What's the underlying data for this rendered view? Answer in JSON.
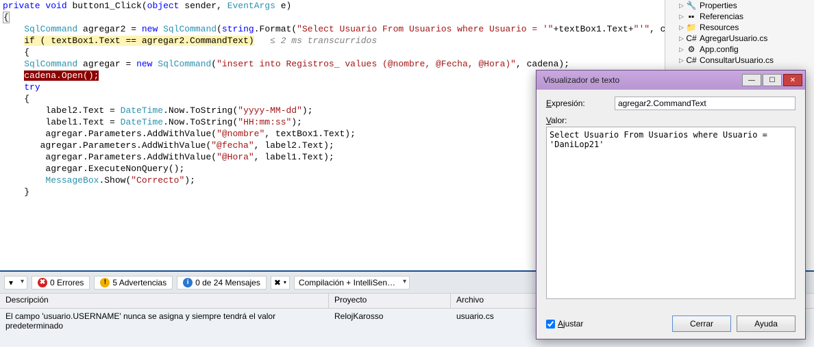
{
  "code": {
    "lines": [
      {
        "segments": [
          {
            "t": "private",
            "c": "kw"
          },
          {
            "t": " ",
            "c": ""
          },
          {
            "t": "void",
            "c": "kw"
          },
          {
            "t": " button1_Click(",
            "c": ""
          },
          {
            "t": "object",
            "c": "kw"
          },
          {
            "t": " sender, ",
            "c": ""
          },
          {
            "t": "EventArgs",
            "c": "type"
          },
          {
            "t": " e)",
            "c": ""
          }
        ]
      },
      {
        "segments": [
          {
            "t": "{",
            "c": "bracket-outline"
          }
        ]
      },
      {
        "segments": [
          {
            "t": "",
            "c": ""
          }
        ]
      },
      {
        "segments": [
          {
            "t": "",
            "c": ""
          }
        ]
      },
      {
        "segments": [
          {
            "t": "    ",
            "c": ""
          },
          {
            "t": "SqlCommand",
            "c": "type"
          },
          {
            "t": " agregar2 = ",
            "c": ""
          },
          {
            "t": "new",
            "c": "kw"
          },
          {
            "t": " ",
            "c": ""
          },
          {
            "t": "SqlCommand",
            "c": "type"
          },
          {
            "t": "(",
            "c": ""
          },
          {
            "t": "string",
            "c": "kw"
          },
          {
            "t": ".Format(",
            "c": ""
          },
          {
            "t": "\"Select Usuario From Usuarios where Usuario = '\"",
            "c": "str"
          },
          {
            "t": "+textBox1.Text+",
            "c": ""
          },
          {
            "t": "\"'\"",
            "c": "str"
          },
          {
            "t": ", cadena));",
            "c": ""
          }
        ]
      },
      {
        "segments": [
          {
            "t": "",
            "c": ""
          }
        ]
      },
      {
        "segments": [
          {
            "t": "    ",
            "c": ""
          },
          {
            "t": "if ( textBox1.Text == agregar2.CommandText)",
            "c": "hl-yellow"
          },
          {
            "t": "   ≤ 2 ms transcurridos",
            "c": "comment"
          }
        ]
      },
      {
        "segments": [
          {
            "t": "    {",
            "c": ""
          }
        ]
      },
      {
        "segments": [
          {
            "t": "",
            "c": ""
          }
        ]
      },
      {
        "segments": [
          {
            "t": "    ",
            "c": ""
          },
          {
            "t": "SqlCommand",
            "c": "type"
          },
          {
            "t": " agregar = ",
            "c": ""
          },
          {
            "t": "new",
            "c": "kw"
          },
          {
            "t": " ",
            "c": ""
          },
          {
            "t": "SqlCommand",
            "c": "type"
          },
          {
            "t": "(",
            "c": ""
          },
          {
            "t": "\"insert into Registros_ values (@nombre, @Fecha, @Hora)\"",
            "c": "str"
          },
          {
            "t": ", cadena);",
            "c": ""
          }
        ]
      },
      {
        "segments": [
          {
            "t": "    ",
            "c": ""
          },
          {
            "t": "cadena.Open();",
            "c": "hl-red"
          }
        ]
      },
      {
        "segments": [
          {
            "t": "",
            "c": ""
          }
        ]
      },
      {
        "segments": [
          {
            "t": "    ",
            "c": ""
          },
          {
            "t": "try",
            "c": "kw"
          }
        ]
      },
      {
        "segments": [
          {
            "t": "    {",
            "c": ""
          }
        ]
      },
      {
        "segments": [
          {
            "t": "        label2.Text = ",
            "c": ""
          },
          {
            "t": "DateTime",
            "c": "type"
          },
          {
            "t": ".Now.ToString(",
            "c": ""
          },
          {
            "t": "\"yyyy-MM-dd\"",
            "c": "str"
          },
          {
            "t": ");",
            "c": ""
          }
        ]
      },
      {
        "segments": [
          {
            "t": "        label1.Text = ",
            "c": ""
          },
          {
            "t": "DateTime",
            "c": "type"
          },
          {
            "t": ".Now.ToString(",
            "c": ""
          },
          {
            "t": "\"HH:mm:ss\"",
            "c": "str"
          },
          {
            "t": ");",
            "c": ""
          }
        ]
      },
      {
        "segments": [
          {
            "t": "        agregar.Parameters.AddWithValue(",
            "c": ""
          },
          {
            "t": "\"@nombre\"",
            "c": "str"
          },
          {
            "t": ", textBox1.Text);",
            "c": ""
          }
        ]
      },
      {
        "segments": [
          {
            "t": "",
            "c": ""
          }
        ]
      },
      {
        "segments": [
          {
            "t": "       agregar.Parameters.AddWithValue(",
            "c": ""
          },
          {
            "t": "\"@fecha\"",
            "c": "str"
          },
          {
            "t": ", label2.Text);",
            "c": ""
          }
        ]
      },
      {
        "segments": [
          {
            "t": "        agregar.Parameters.AddWithValue(",
            "c": ""
          },
          {
            "t": "\"@Hora\"",
            "c": "str"
          },
          {
            "t": ", label1.Text);",
            "c": ""
          }
        ]
      },
      {
        "segments": [
          {
            "t": "        agregar.ExecuteNonQuery();",
            "c": ""
          }
        ]
      },
      {
        "segments": [
          {
            "t": "        ",
            "c": ""
          },
          {
            "t": "MessageBox",
            "c": "type"
          },
          {
            "t": ".Show(",
            "c": ""
          },
          {
            "t": "\"Correcto\"",
            "c": "str"
          },
          {
            "t": ");",
            "c": ""
          }
        ]
      },
      {
        "segments": [
          {
            "t": "    }",
            "c": ""
          }
        ]
      }
    ]
  },
  "solution_tree": {
    "items": [
      {
        "icon": "wrench",
        "label": "Properties"
      },
      {
        "icon": "refs",
        "label": "Referencias"
      },
      {
        "icon": "folder",
        "label": "Resources"
      },
      {
        "icon": "cs",
        "label": "AgregarUsuario.cs"
      },
      {
        "icon": "config",
        "label": "App.config"
      },
      {
        "icon": "cs",
        "label": "ConsultarUsuario.cs"
      }
    ]
  },
  "error_panel": {
    "buttons": {
      "errors": "0 Errores",
      "warnings": "5 Advertencias",
      "messages": "0 de 24 Mensajes"
    },
    "dropdown": "Compilación + IntelliSen…",
    "columns": {
      "desc": "Descripción",
      "proj": "Proyecto",
      "arch": "Archivo"
    },
    "rows": [
      {
        "desc": "El campo 'usuario.USERNAME' nunca se asigna y siempre tendrá el valor predeterminado",
        "proj": "RelojKarosso",
        "arch": "usuario.cs"
      }
    ]
  },
  "dialog": {
    "title": "Visualizador de texto",
    "expr_label": "Expresión:",
    "expr_value": "agregar2.CommandText",
    "valor_label": "Valor:",
    "valor_text": "Select Usuario From Usuarios where Usuario = 'DaniLop21'",
    "wrap_label": "Ajustar",
    "close_btn": "Cerrar",
    "help_btn": "Ayuda"
  }
}
